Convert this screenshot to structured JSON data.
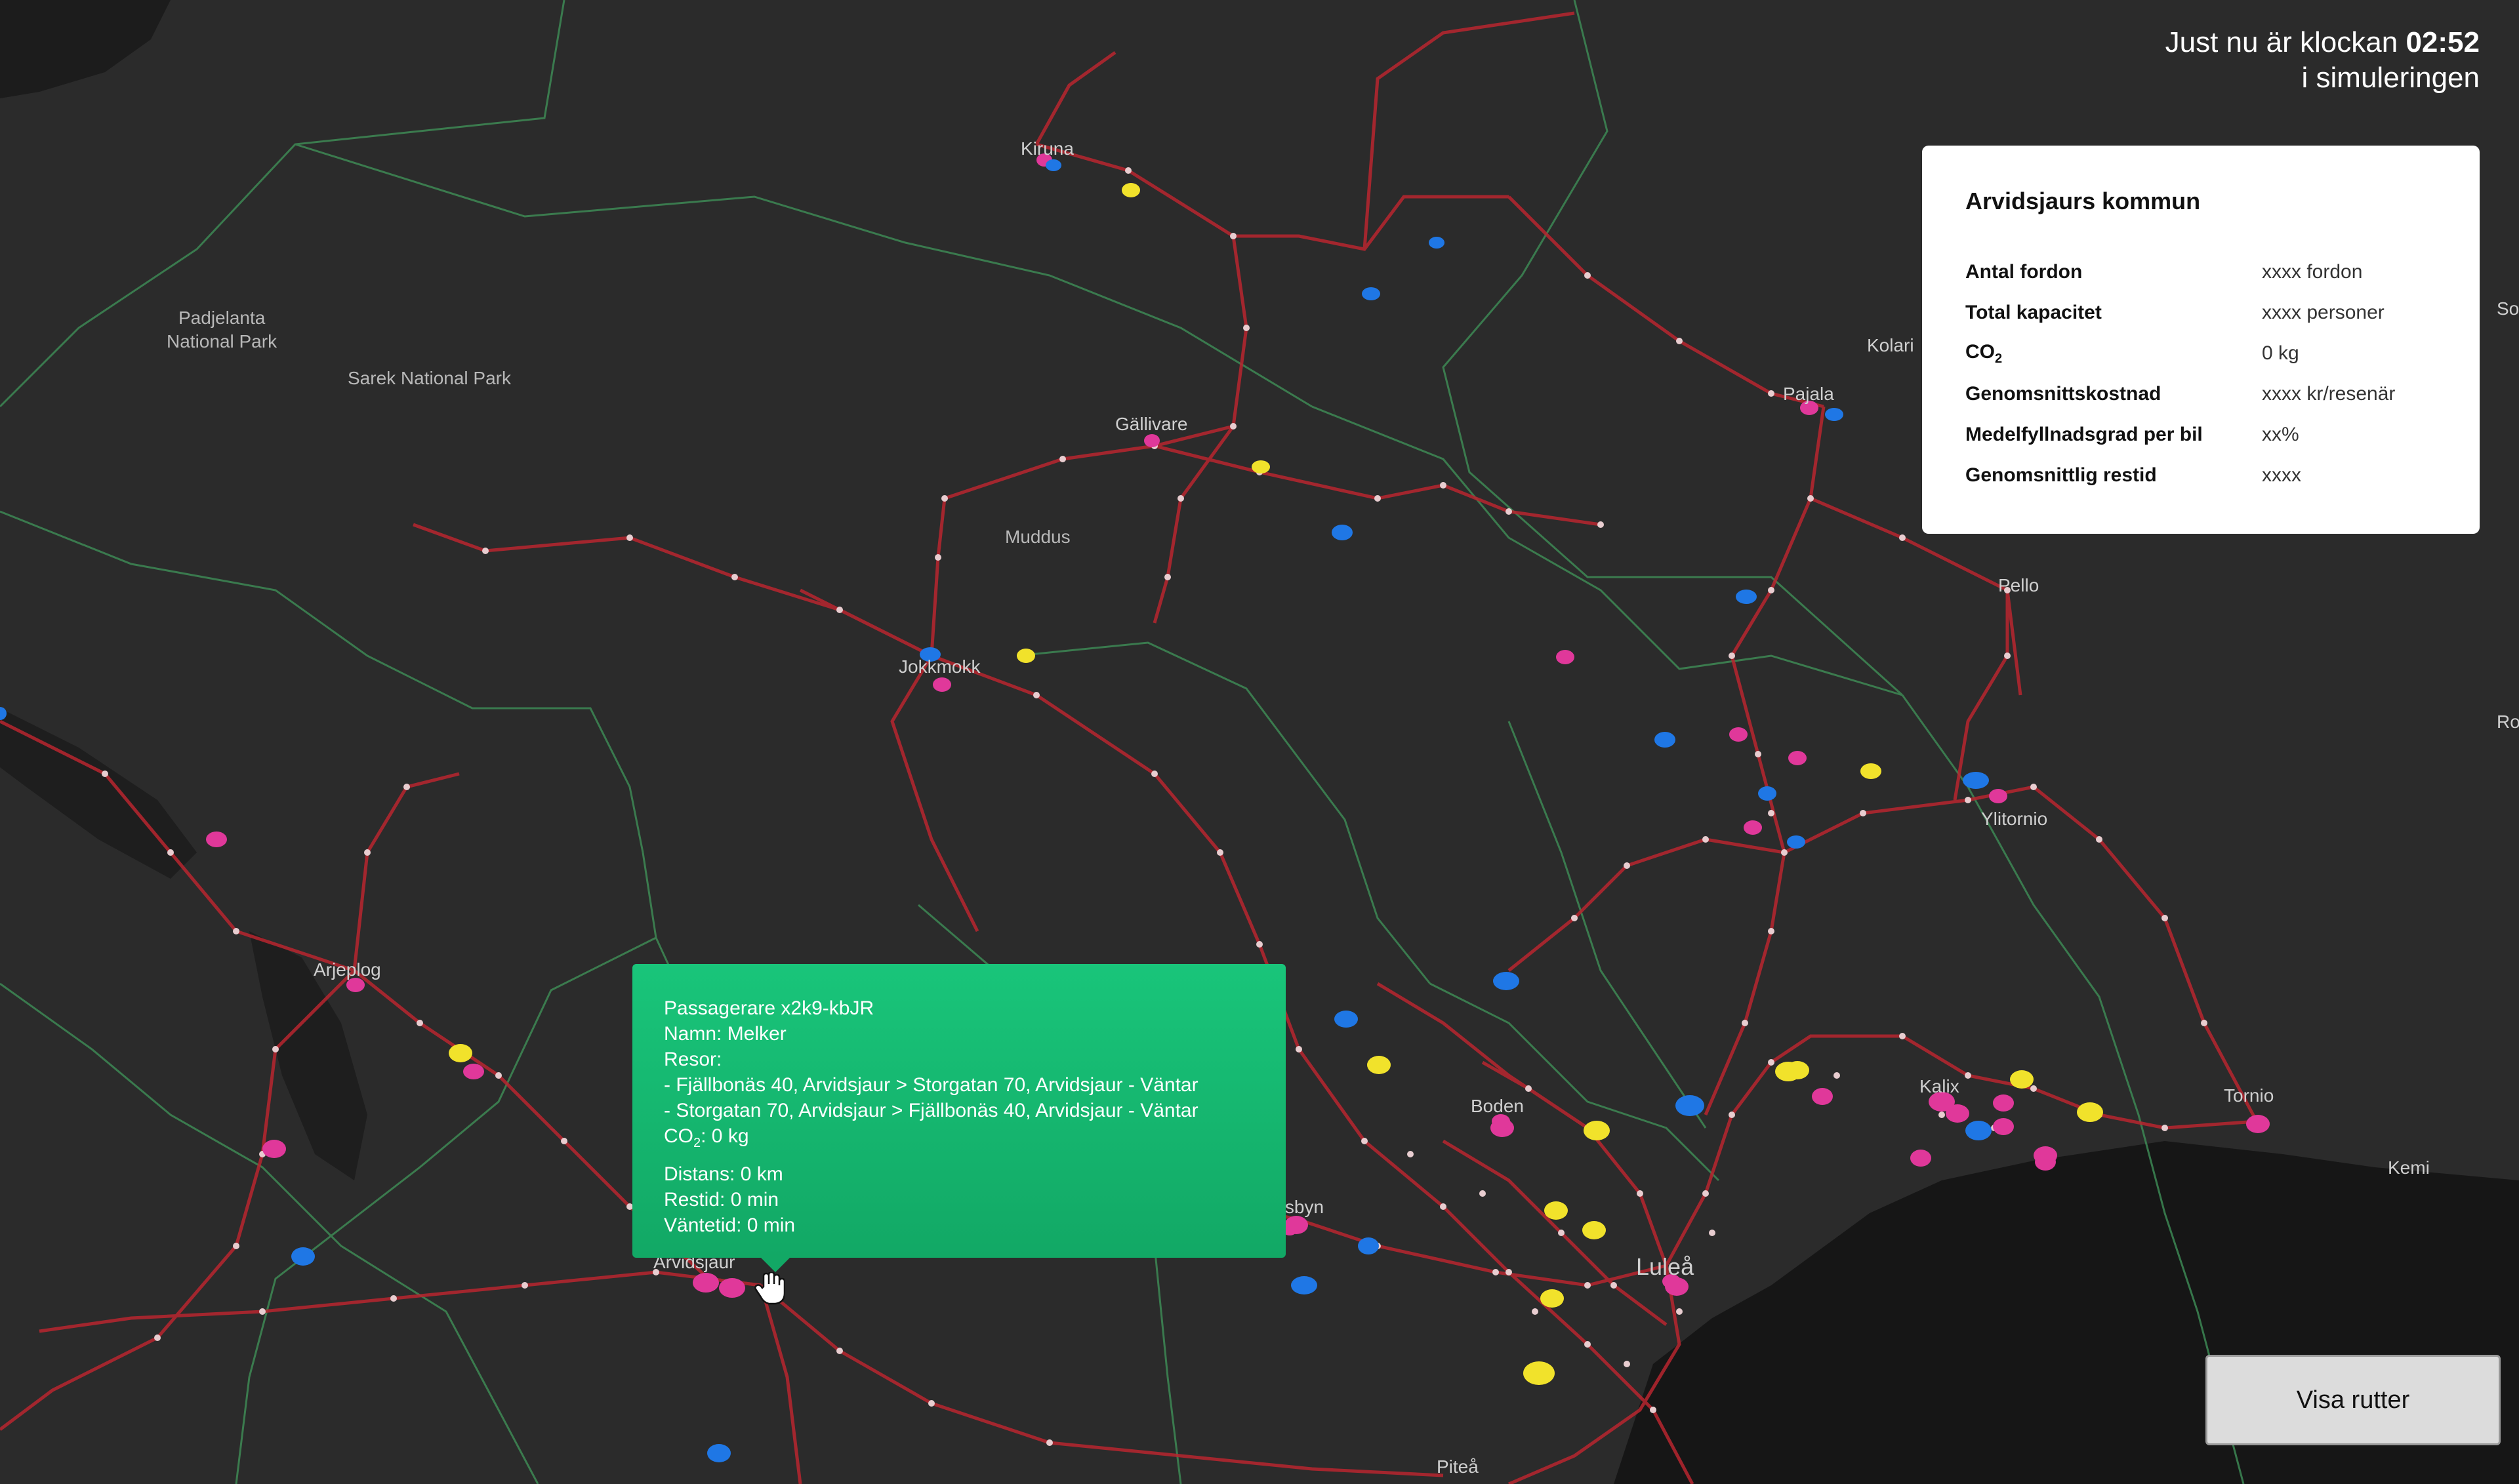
{
  "clock": {
    "prefix": "Just nu är klockan",
    "time": "02:52",
    "suffix": "i simuleringen"
  },
  "info_panel": {
    "title": "Arvidsjaurs kommun",
    "stats": [
      {
        "label": "Antal fordon",
        "value": "xxxx fordon"
      },
      {
        "label": "Total kapacitet",
        "value": "xxxx personer"
      },
      {
        "label": "CO",
        "label_sub": "2",
        "value": "0 kg"
      },
      {
        "label": "Genomsnittskostnad",
        "value": "xxxx kr/resenär"
      },
      {
        "label": "Medelfyllnadsgrad per bil",
        "value": "xx%"
      },
      {
        "label": "Genomsnittlig restid",
        "value": "xxxx"
      }
    ]
  },
  "tooltip": {
    "title": "Passagerare x2k9-kbJR",
    "name": "Namn: Melker",
    "trips_heading": "Resor:",
    "trips": [
      "- Fjällbonäs 40, Arvidsjaur > Storgatan 70, Arvidsjaur - Väntar",
      "- Storgatan 70, Arvidsjaur > Fjällbonäs 40, Arvidsjaur - Väntar"
    ],
    "co2_label": "CO",
    "co2_sub": "2",
    "co2_value": ": 0 kg",
    "distance": "Distans: 0 km",
    "travel_time": "Restid: 0 min",
    "wait_time": "Väntetid: 0 min"
  },
  "button": {
    "label": "Visa rutter"
  },
  "map": {
    "place_labels": [
      "Kiruna",
      "Padjelanta",
      "National Park",
      "Sarek National Park",
      "Gällivare",
      "Muddus",
      "Jokkmokk",
      "Kolari",
      "Pajala",
      "Pello",
      "Ylitornio",
      "Arjeplog",
      "Boden",
      "Kalix",
      "Tornio",
      "Kemi",
      "Luleå",
      "Arvidsjaur",
      "Älvsbyn",
      "Piteå",
      "So",
      "Ro"
    ],
    "colors": {
      "background": "#2b2b2b",
      "water": "#161616",
      "route": "#b8262f",
      "border": "#3f8f57",
      "stop": "#e8cdd0",
      "passenger": "#e0389a",
      "vehicle_blue": "#1f77e5",
      "vehicle_yellow": "#f1e22b"
    }
  }
}
